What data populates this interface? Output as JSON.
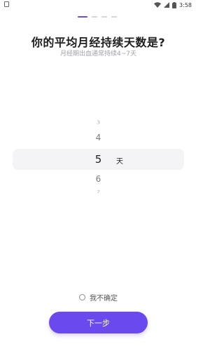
{
  "status_bar": {
    "time": "3:58",
    "icons": [
      "app-notification-icon",
      "wifi-icon",
      "signal-icon",
      "battery-icon"
    ]
  },
  "progress": {
    "total_steps": 4,
    "current_step": 1,
    "accent_color": "#6a49ee"
  },
  "question": {
    "title": "你的平均月经持续天数是?",
    "subtitle": "月经期出血通常持续4~7天"
  },
  "picker": {
    "items": [
      "3",
      "4",
      "5",
      "6",
      "7"
    ],
    "selected_value": "5",
    "unit": "天"
  },
  "unsure_option": {
    "label": "我不确定",
    "checked": false
  },
  "next_button": {
    "label": "下一步",
    "color": "#6a49ee"
  }
}
